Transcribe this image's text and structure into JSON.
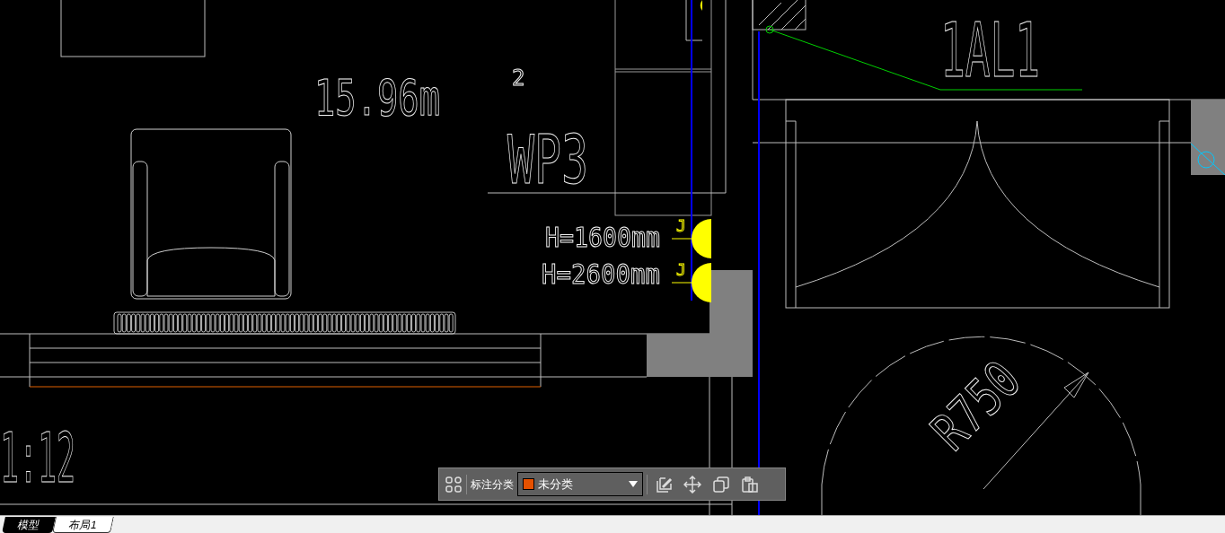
{
  "drawing": {
    "labels": [
      {
        "text": "15.96m",
        "kind": "annotation"
      },
      {
        "text": "2",
        "kind": "annotation"
      },
      {
        "text": "WP3",
        "kind": "annotation"
      },
      {
        "text": "1AL1",
        "kind": "annotation"
      },
      {
        "text": "H=1600mm",
        "kind": "annotation"
      },
      {
        "text": "H=2600mm",
        "kind": "annotation"
      },
      {
        "text": "J",
        "kind": "socket-tag"
      },
      {
        "text": "J",
        "kind": "socket-tag"
      },
      {
        "text": "R750",
        "kind": "annotation"
      },
      {
        "text": "1:12",
        "kind": "annotation"
      }
    ]
  },
  "toolbar": {
    "category_label": "标注分类",
    "category": {
      "value": "未分类",
      "color": "#e65100"
    }
  },
  "tabs": [
    {
      "label": "模型",
      "selected": true
    },
    {
      "label": "布局1",
      "selected": false
    }
  ]
}
